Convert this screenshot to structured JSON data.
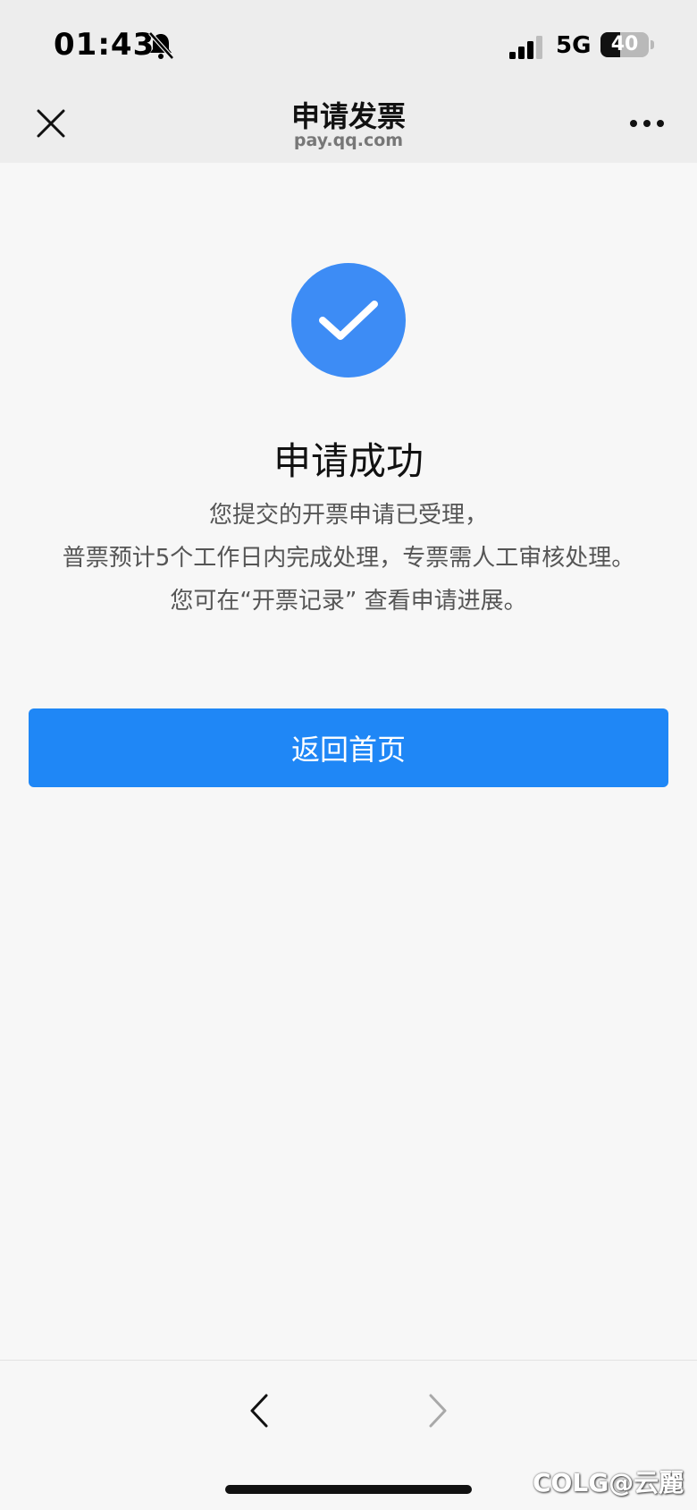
{
  "status_bar": {
    "time": "01:43",
    "network": "5G",
    "battery_level": "40",
    "battery_percent": 40,
    "icons": [
      "bell-muted-icon",
      "signal-icon",
      "battery-icon"
    ]
  },
  "nav": {
    "title": "申请发票",
    "subtitle": "pay.qq.com",
    "icons": [
      "close-icon",
      "more-icon"
    ]
  },
  "result": {
    "icon": "check-circle-icon",
    "title": "申请成功",
    "lines": [
      "您提交的开票申请已受理，",
      "普票预计5个工作日内完成处理，专票需人工审核处理。",
      "您可在“开票记录” 查看申请进展。"
    ]
  },
  "actions": {
    "home_label": "返回首页"
  },
  "toolbar": {
    "icons": [
      "back-chevron-icon",
      "forward-chevron-icon"
    ]
  },
  "watermark": "COLG@云麗",
  "colors": {
    "accent": "#1f87f6",
    "success": "#3d8cf5",
    "header_bg": "#ededed",
    "page_bg": "#f7f7f7"
  }
}
